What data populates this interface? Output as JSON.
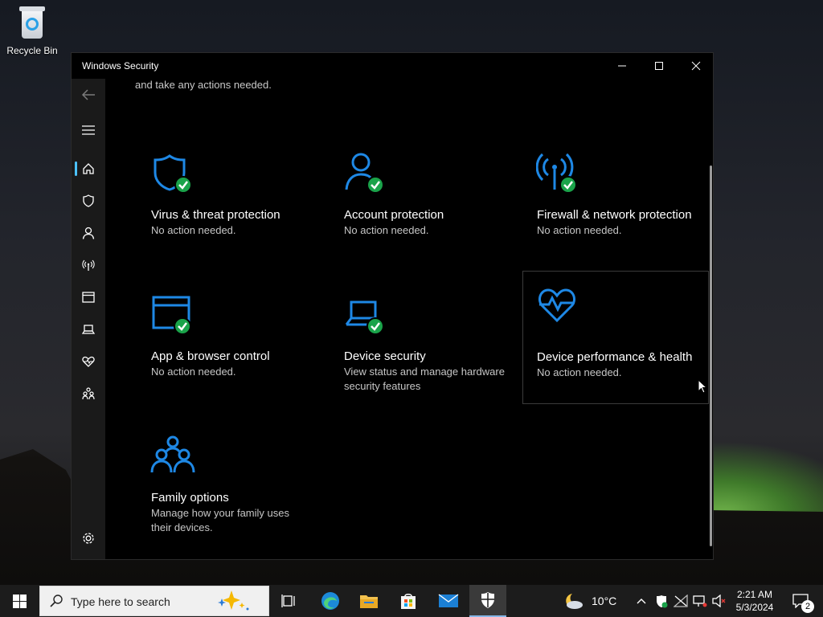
{
  "desktop": {
    "recycle_bin_label": "Recycle Bin"
  },
  "window": {
    "title": "Windows Security",
    "intro_text": "and take any actions needed."
  },
  "sidebar": {
    "items": [
      {
        "icon": "back-arrow-icon"
      },
      {
        "icon": "hamburger-menu-icon"
      },
      {
        "icon": "home-icon"
      },
      {
        "icon": "shield-icon"
      },
      {
        "icon": "person-icon"
      },
      {
        "icon": "wifi-antenna-icon"
      },
      {
        "icon": "browser-window-icon"
      },
      {
        "icon": "laptop-icon"
      },
      {
        "icon": "heart-icon"
      },
      {
        "icon": "family-icon"
      },
      {
        "icon": "gear-icon"
      }
    ]
  },
  "tiles": [
    {
      "name": "Virus & threat protection",
      "desc": "No action needed.",
      "icon": "shield-icon",
      "status": "ok"
    },
    {
      "name": "Account protection",
      "desc": "No action needed.",
      "icon": "person-icon",
      "status": "ok"
    },
    {
      "name": "Firewall & network protection",
      "desc": "No action needed.",
      "icon": "wifi-antenna-icon",
      "status": "ok"
    },
    {
      "name": "App & browser control",
      "desc": "No action needed.",
      "icon": "browser-window-icon",
      "status": "ok"
    },
    {
      "name": "Device security",
      "desc": "View status and manage hardware security features",
      "icon": "laptop-icon",
      "status": "ok"
    },
    {
      "name": "Device performance & health",
      "desc": "No action needed.",
      "icon": "heart-icon",
      "status": "none"
    },
    {
      "name": "Family options",
      "desc": "Manage how your family uses their devices.",
      "icon": "family-icon",
      "status": "none"
    }
  ],
  "taskbar": {
    "search_placeholder": "Type here to search",
    "weather_temp": "10°C",
    "time": "2:21 AM",
    "date": "5/3/2024",
    "notification_count": "2"
  },
  "colors": {
    "accent": "#1e88e5",
    "ok_green": "#1aa34a",
    "window_bg": "#000000",
    "sidebar_bg": "#1a1a1a"
  }
}
